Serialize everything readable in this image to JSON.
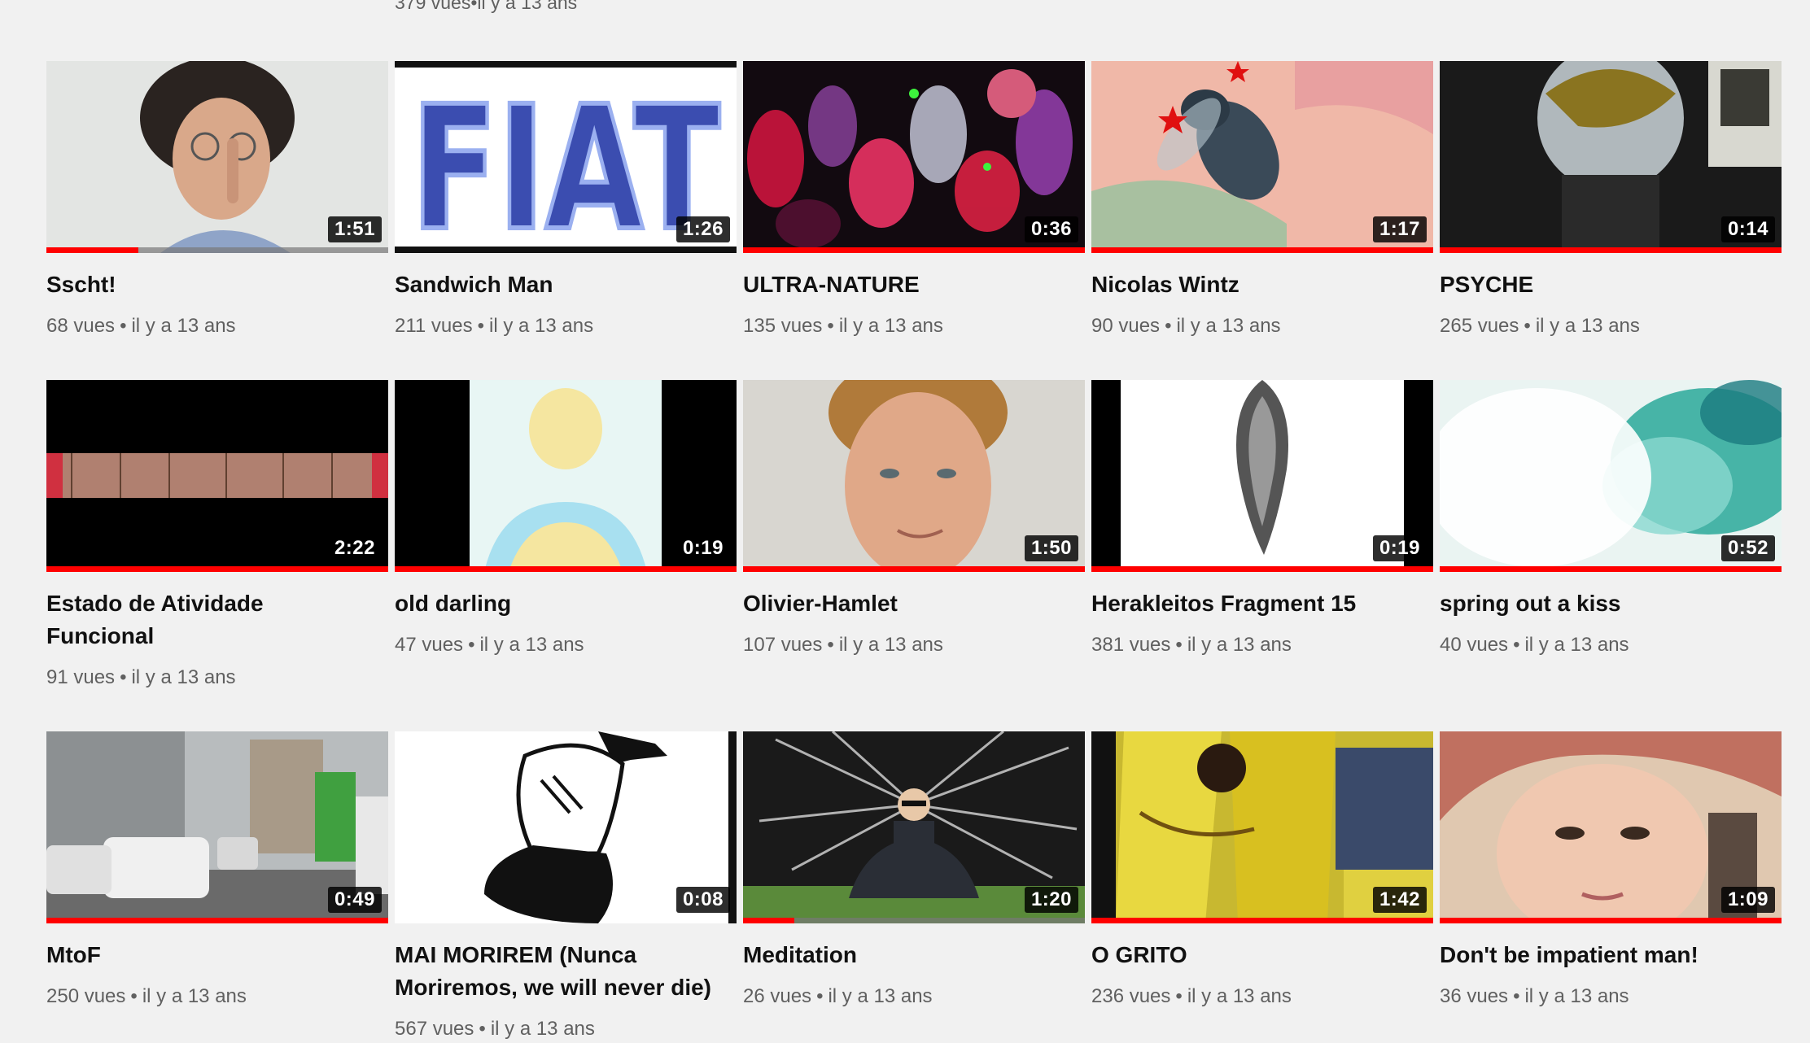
{
  "top_partial": {
    "views": "379 vues",
    "age": "il y a 13 ans"
  },
  "separator": "•",
  "videos": [
    {
      "title": "Sscht!",
      "views": "68 vues",
      "age": "il y a 13 ans",
      "duration": "1:51",
      "watched": 0.27
    },
    {
      "title": "Sandwich Man",
      "views": "211 vues",
      "age": "il y a 13 ans",
      "duration": "1:26",
      "watched": 0,
      "thumb_text": "FIAT"
    },
    {
      "title": "ULTRA-NATURE",
      "views": "135 vues",
      "age": "il y a 13 ans",
      "duration": "0:36",
      "watched": 1
    },
    {
      "title": "Nicolas Wintz",
      "views": "90 vues",
      "age": "il y a 13 ans",
      "duration": "1:17",
      "watched": 1
    },
    {
      "title": "PSYCHE",
      "views": "265 vues",
      "age": "il y a 13 ans",
      "duration": "0:14",
      "watched": 1
    },
    {
      "title": "Estado de Atividade Funcional",
      "views": "91 vues",
      "age": "il y a 13 ans",
      "duration": "2:22",
      "watched": 1
    },
    {
      "title": "old darling",
      "views": "47 vues",
      "age": "il y a 13 ans",
      "duration": "0:19",
      "watched": 1
    },
    {
      "title": "Olivier-Hamlet",
      "views": "107 vues",
      "age": "il y a 13 ans",
      "duration": "1:50",
      "watched": 1
    },
    {
      "title": "Herakleitos Fragment 15",
      "views": "381 vues",
      "age": "il y a 13 ans",
      "duration": "0:19",
      "watched": 1
    },
    {
      "title": "spring out a kiss",
      "views": "40 vues",
      "age": "il y a 13 ans",
      "duration": "0:52",
      "watched": 1
    },
    {
      "title": "MtoF",
      "views": "250 vues",
      "age": "il y a 13 ans",
      "duration": "0:49",
      "watched": 1
    },
    {
      "title": "MAI MORIREM (Nunca Moriremos, we will never die)",
      "views": "567 vues",
      "age": "il y a 13 ans",
      "duration": "0:08",
      "watched": 0
    },
    {
      "title": "Meditation",
      "views": "26 vues",
      "age": "il y a 13 ans",
      "duration": "1:20",
      "watched": 0.15
    },
    {
      "title": "O GRITO",
      "views": "236 vues",
      "age": "il y a 13 ans",
      "duration": "1:42",
      "watched": 1
    },
    {
      "title": "Don't be impatient man!",
      "views": "36 vues",
      "age": "il y a 13 ans",
      "duration": "1:09",
      "watched": 1
    }
  ]
}
